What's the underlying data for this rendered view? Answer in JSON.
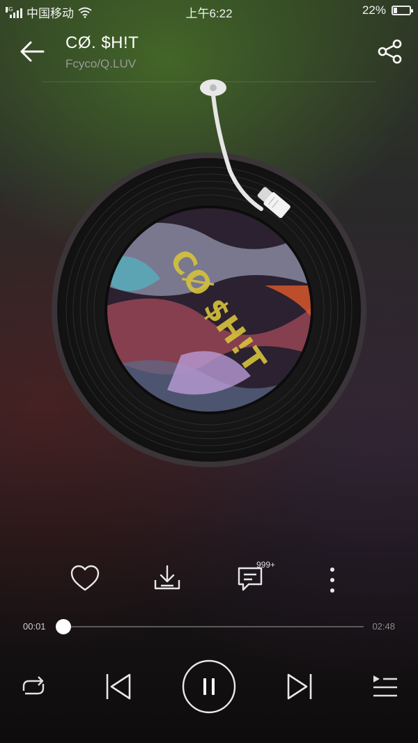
{
  "status_bar": {
    "network_type": "4G",
    "carrier": "中国移动",
    "time": "上午6:22",
    "battery_percent": "22%",
    "battery_level": 0.22
  },
  "header": {
    "song_title": "CØ. $H!T",
    "artist": "Fcyco/Q.LUV"
  },
  "album_art": {
    "text": "CØ $H!T"
  },
  "actions": {
    "comment_count": "999+"
  },
  "playback": {
    "current_time": "00:01",
    "total_time": "02:48",
    "progress": 0.006,
    "state": "playing"
  },
  "icons": {
    "back": "arrow-left-icon",
    "share": "share-icon",
    "like": "heart-icon",
    "download": "download-icon",
    "comment": "comment-icon",
    "more": "more-vertical-icon",
    "repeat": "repeat-icon",
    "previous": "skip-previous-icon",
    "pause": "pause-icon",
    "next": "skip-next-icon",
    "playlist": "playlist-icon"
  },
  "colors": {
    "accent": "#ffffff",
    "text_secondary": "#9a9a9a",
    "track": "#5a5a5a"
  }
}
